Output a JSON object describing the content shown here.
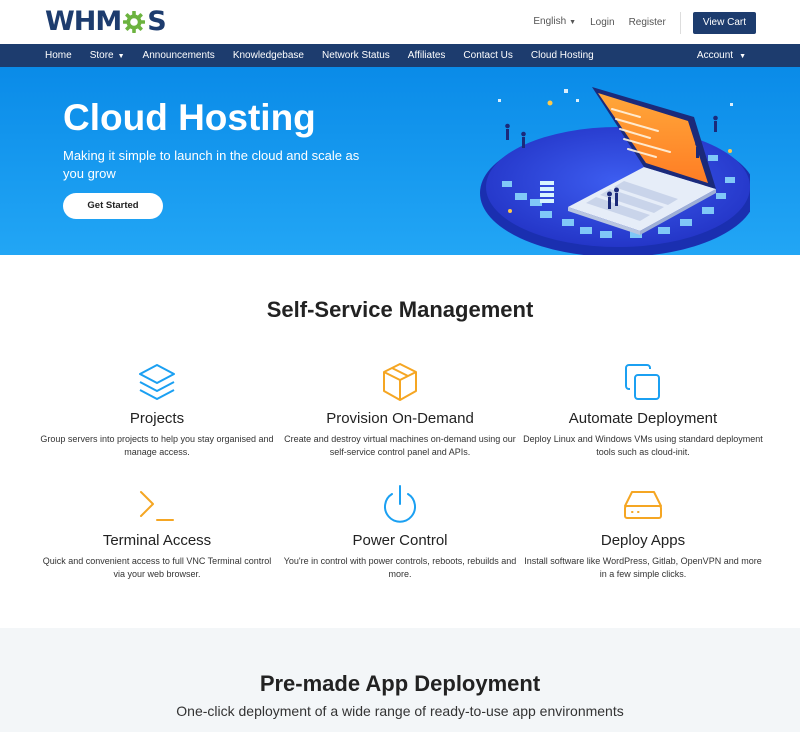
{
  "brand": {
    "logo_prefix": "WHM",
    "logo_suffix": "S",
    "colors": {
      "navy": "#1d3c6e",
      "green": "#6cb33f",
      "blue": "#1ba0f2",
      "orange": "#f5a623"
    }
  },
  "topbar": {
    "language": "English",
    "login": "Login",
    "register": "Register",
    "cart": "View Cart"
  },
  "nav": {
    "items": [
      {
        "label": "Home",
        "dropdown": false
      },
      {
        "label": "Store",
        "dropdown": true
      },
      {
        "label": "Announcements",
        "dropdown": false
      },
      {
        "label": "Knowledgebase",
        "dropdown": false
      },
      {
        "label": "Network Status",
        "dropdown": false
      },
      {
        "label": "Affiliates",
        "dropdown": false
      },
      {
        "label": "Contact Us",
        "dropdown": false
      },
      {
        "label": "Cloud Hosting",
        "dropdown": false
      }
    ],
    "account": "Account"
  },
  "hero": {
    "title": "Cloud Hosting",
    "subtitle": "Making it simple to launch in the cloud and scale as you grow",
    "cta": "Get Started"
  },
  "features_section": {
    "title": "Self-Service Management",
    "items": [
      {
        "icon": "layers-icon",
        "title": "Projects",
        "desc": "Group servers into projects to help you stay organised and manage access."
      },
      {
        "icon": "box-icon",
        "title": "Provision On-Demand",
        "desc": "Create and destroy virtual machines on-demand using our self-service control panel and APIs."
      },
      {
        "icon": "copy-icon",
        "title": "Automate Deployment",
        "desc": "Deploy Linux and Windows VMs using standard deployment tools such as cloud-init."
      },
      {
        "icon": "terminal-icon",
        "title": "Terminal Access",
        "desc": "Quick and convenient access to full VNC Terminal control via your web browser."
      },
      {
        "icon": "power-icon",
        "title": "Power Control",
        "desc": "You're in control with power controls, reboots, rebuilds and more."
      },
      {
        "icon": "hard-drive-icon",
        "title": "Deploy Apps",
        "desc": "Install software like WordPress, Gitlab, OpenVPN and more in a few simple clicks."
      }
    ]
  },
  "apps_section": {
    "title": "Pre-made App Deployment",
    "subtitle": "One-click deployment of a wide range of ready-to-use app environments"
  }
}
